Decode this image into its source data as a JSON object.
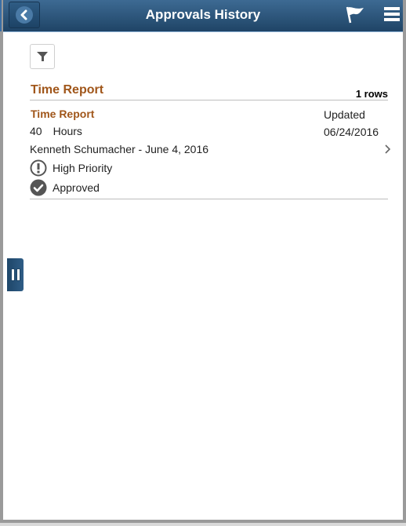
{
  "header": {
    "title": "Approvals History",
    "back_icon": "chevron-left-icon",
    "flag_icon": "flag-icon",
    "menu_icon": "hamburger-menu-icon"
  },
  "toolbar": {
    "filter_icon": "filter-icon"
  },
  "section": {
    "title": "Time Report",
    "rows_count": "1 rows"
  },
  "items": [
    {
      "title": "Time Report",
      "quantity": "40",
      "unit": "Hours",
      "person": "Kenneth Schumacher - June 4, 2016",
      "priority": "High Priority",
      "status": "Approved",
      "updated_label": "Updated",
      "updated_date": "06/24/2016"
    }
  ],
  "colors": {
    "header_bg": "#2a5478",
    "accent": "#a0561a"
  }
}
